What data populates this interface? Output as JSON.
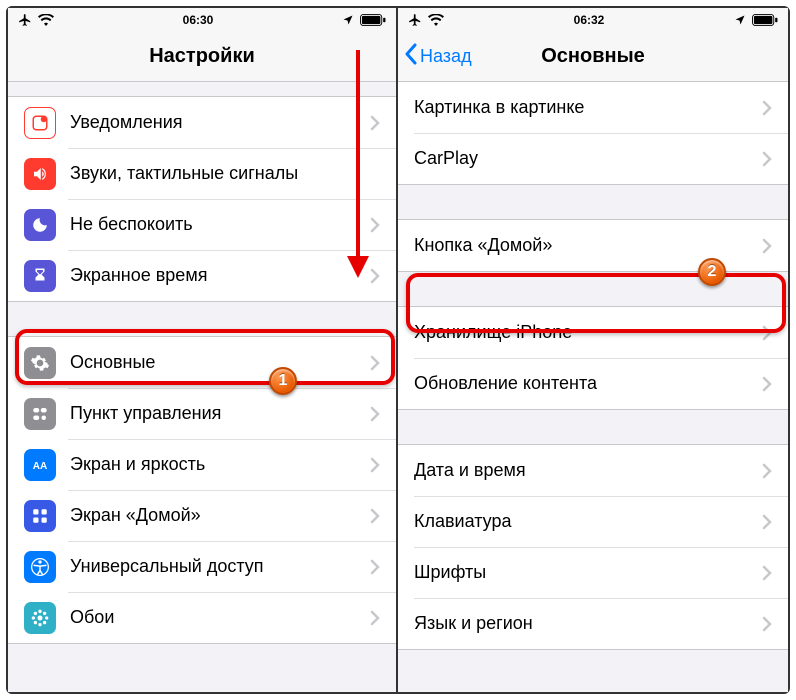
{
  "left": {
    "time": "06:30",
    "title": "Настройки",
    "group1": [
      {
        "label": "Уведомления"
      },
      {
        "label": "Звуки, тактильные сигналы"
      },
      {
        "label": "Не беспокоить"
      },
      {
        "label": "Экранное время"
      }
    ],
    "group2": [
      {
        "label": "Основные"
      },
      {
        "label": "Пункт управления"
      },
      {
        "label": "Экран и яркость"
      },
      {
        "label": "Экран «Домой»"
      },
      {
        "label": "Универсальный доступ"
      },
      {
        "label": "Обои"
      }
    ],
    "badge": "1"
  },
  "right": {
    "time": "06:32",
    "back": "Назад",
    "title": "Основные",
    "group1": [
      {
        "label": "Картинка в картинке"
      },
      {
        "label": "CarPlay"
      }
    ],
    "group2": [
      {
        "label": "Кнопка «Домой»"
      }
    ],
    "group3": [
      {
        "label": "Хранилище iPhone"
      },
      {
        "label": "Обновление контента"
      }
    ],
    "group4": [
      {
        "label": "Дата и время"
      },
      {
        "label": "Клавиатура"
      },
      {
        "label": "Шрифты"
      },
      {
        "label": "Язык и регион"
      }
    ],
    "badge": "2"
  }
}
